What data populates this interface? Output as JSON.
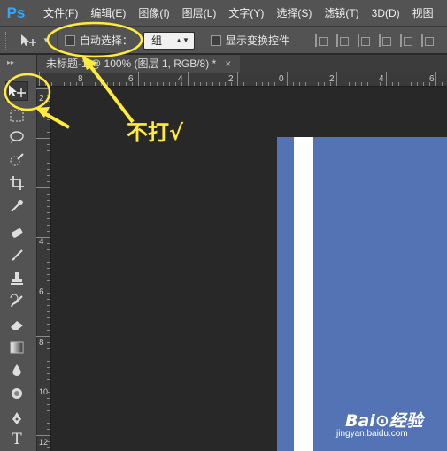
{
  "app": {
    "logo": "Ps"
  },
  "menu": {
    "items": [
      "文件(F)",
      "编辑(E)",
      "图像(I)",
      "图层(L)",
      "文字(Y)",
      "选择(S)",
      "滤镜(T)",
      "3D(D)",
      "视图"
    ]
  },
  "options": {
    "auto_select_label": "自动选择：",
    "auto_select_checked": false,
    "group_value": "组",
    "show_transform_label": "显示变换控件",
    "show_transform_checked": false
  },
  "document": {
    "tab_title": "未标题-1 @ 100% (图层 1, RGB/8) *",
    "close_glyph": "×"
  },
  "rulers": {
    "top_labels": [
      "8",
      "6",
      "4",
      "2",
      "0",
      "2",
      "4",
      "6"
    ],
    "left_labels": [
      "2",
      "4",
      "6",
      "8",
      "10",
      "12"
    ]
  },
  "annotation": {
    "text": "不打√",
    "color": "#ffeb3b"
  },
  "watermark": {
    "brand": "Bai⊙经验",
    "url": "jingyan.baidu.com"
  },
  "colors": {
    "canvas_blue": "#5373b5",
    "canvas_white": "#ffffff",
    "annotation_yellow": "#ffeb3b",
    "ps_blue": "#31a8ff"
  },
  "icons": {
    "tools": [
      "move-icon",
      "marquee-icon",
      "lasso-icon",
      "quick-select-icon",
      "crop-icon",
      "eyedropper-icon",
      "healing-icon",
      "brush-icon",
      "stamp-icon",
      "history-brush-icon",
      "eraser-icon",
      "gradient-icon",
      "blur-icon",
      "dodge-icon",
      "pen-icon",
      "type-icon"
    ]
  }
}
